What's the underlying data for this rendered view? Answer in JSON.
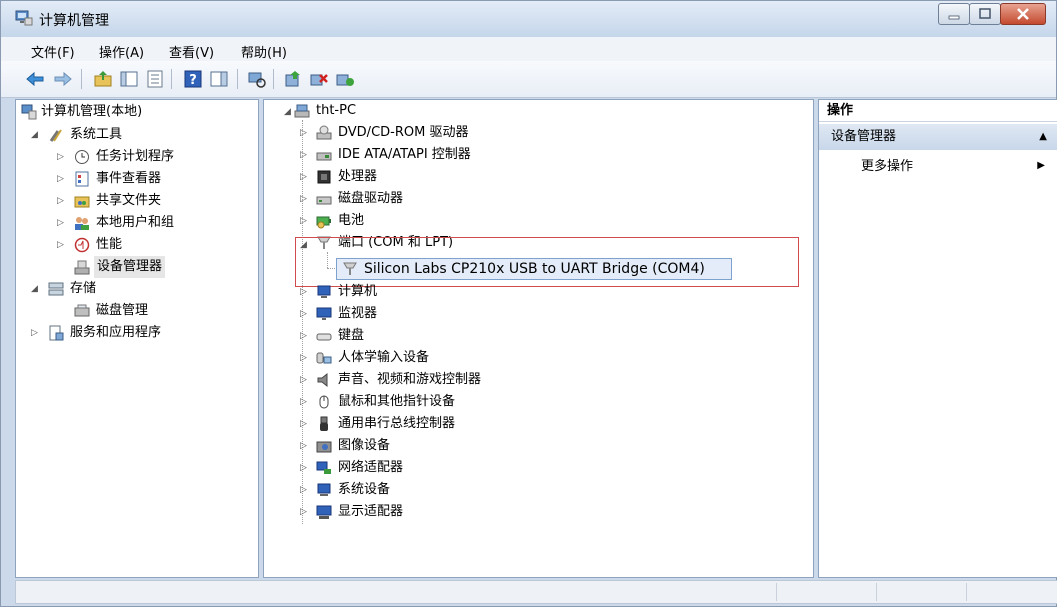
{
  "window": {
    "title": "计算机管理"
  },
  "menu": [
    "文件(F)",
    "操作(A)",
    "查看(V)",
    "帮助(H)"
  ],
  "left_tree": {
    "root": "计算机管理(本地)",
    "system_tools": "系统工具",
    "system_tools_children": [
      "任务计划程序",
      "事件查看器",
      "共享文件夹",
      "本地用户和组",
      "性能",
      "设备管理器"
    ],
    "storage": "存储",
    "storage_children": [
      "磁盘管理"
    ],
    "services": "服务和应用程序"
  },
  "device_tree": {
    "root": "tht-PC",
    "categories_top": [
      "DVD/CD-ROM 驱动器",
      "IDE ATA/ATAPI 控制器",
      "处理器",
      "磁盘驱动器",
      "电池"
    ],
    "ports": "端口 (COM 和 LPT)",
    "port_device": "Silicon Labs CP210x USB to UART Bridge (COM4)",
    "categories_bottom": [
      "计算机",
      "监视器",
      "键盘",
      "人体学输入设备",
      "声音、视频和游戏控制器",
      "鼠标和其他指针设备",
      "通用串行总线控制器",
      "图像设备",
      "网络适配器",
      "系统设备",
      "显示适配器"
    ]
  },
  "actions": {
    "header": "操作",
    "section": "设备管理器",
    "more": "更多操作"
  }
}
